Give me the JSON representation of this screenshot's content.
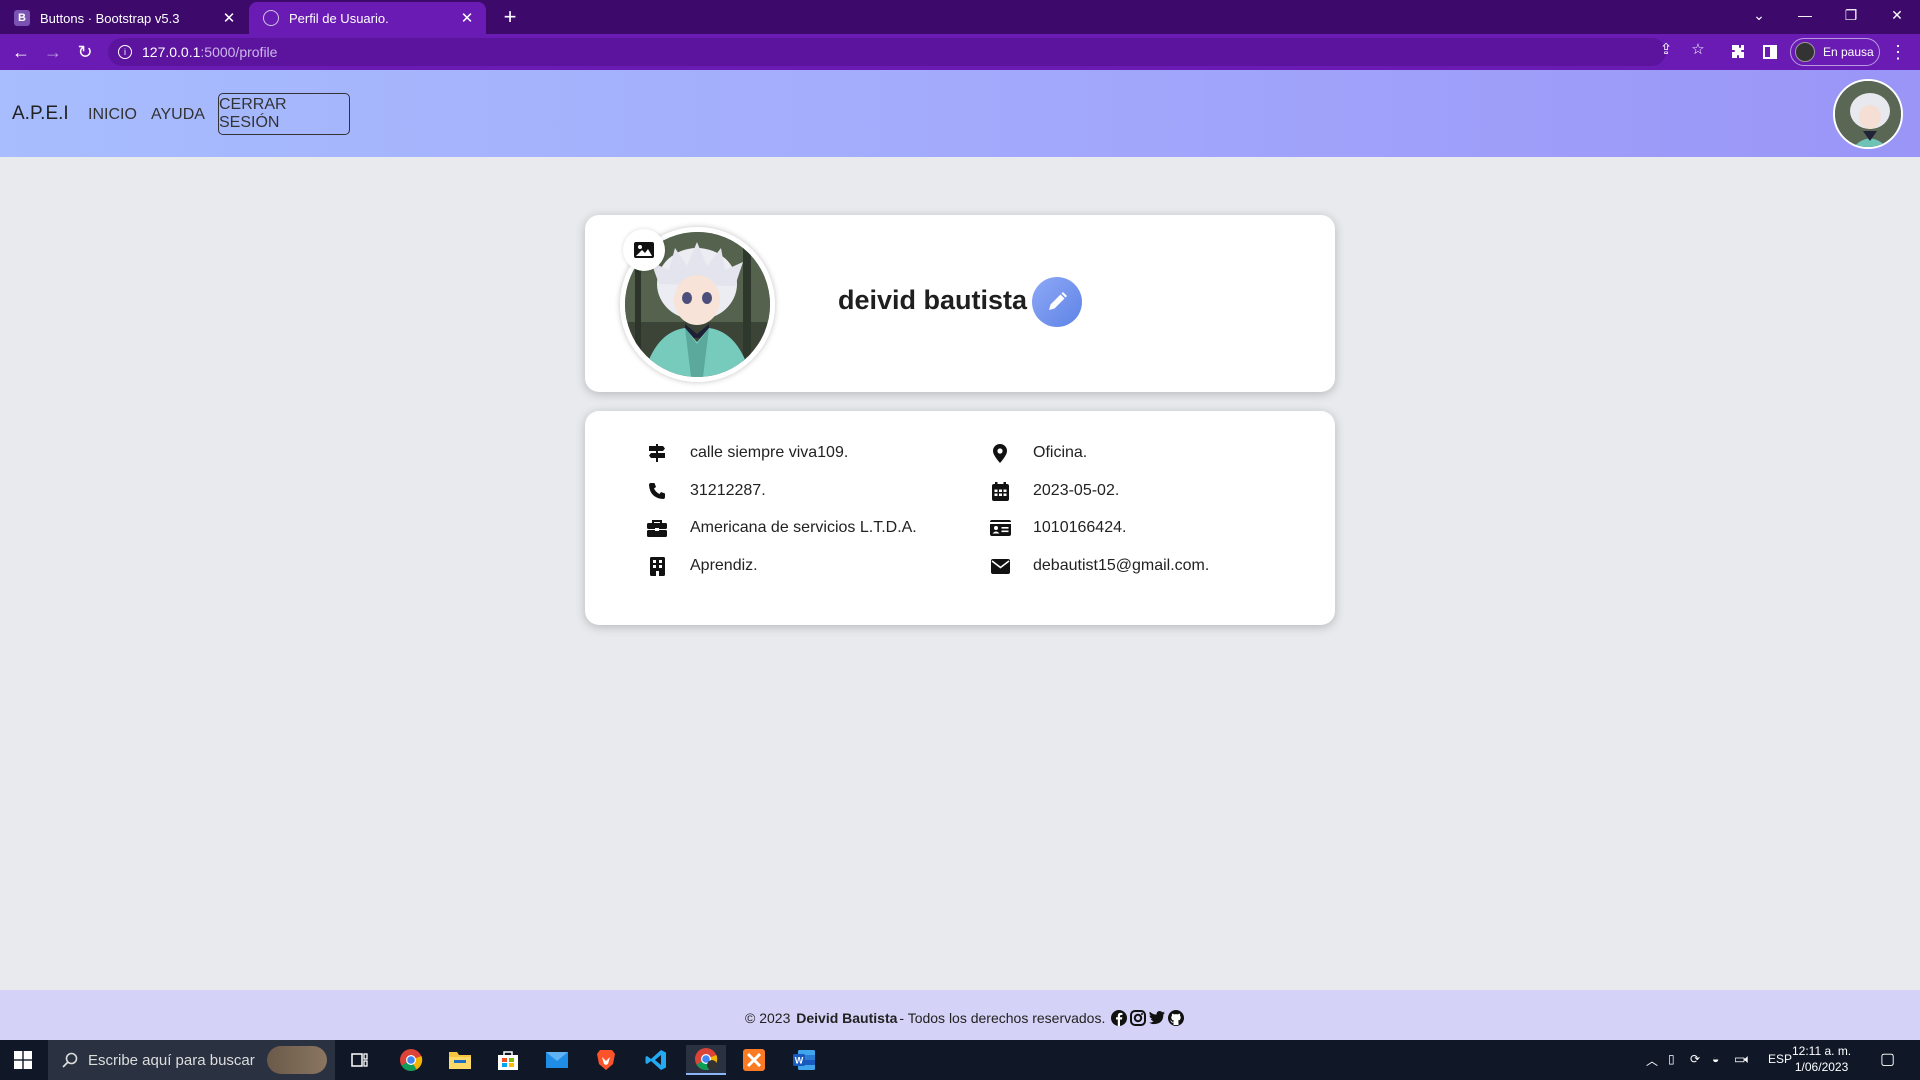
{
  "browser": {
    "tabs": [
      {
        "favicon": "B",
        "title": "Buttons · Bootstrap v5.3"
      },
      {
        "favicon": "globe-icon",
        "title": "Perfil de Usuario."
      }
    ],
    "url_host": "127.0.0.1",
    "url_path": ":5000/profile",
    "profile_label": "En pausa"
  },
  "navbar": {
    "brand": "A.P.E.I",
    "links": [
      "INICIO",
      "AYUDA"
    ],
    "logout": "CERRAR SESIÓN"
  },
  "profile": {
    "name": "deivid bautista"
  },
  "info": {
    "left": [
      {
        "icon": "signpost-icon",
        "text": "calle siempre viva109."
      },
      {
        "icon": "phone-icon",
        "text": "31212287."
      },
      {
        "icon": "briefcase-icon",
        "text": "Americana de servicios L.T.D.A."
      },
      {
        "icon": "building-icon",
        "text": "Aprendiz."
      }
    ],
    "right": [
      {
        "icon": "location-pin-icon",
        "text": "Oficina."
      },
      {
        "icon": "calendar-icon",
        "text": "2023-05-02."
      },
      {
        "icon": "id-card-icon",
        "text": "1010166424."
      },
      {
        "icon": "envelope-icon",
        "text": "debautist15@gmail.com."
      }
    ]
  },
  "footer": {
    "prefix": "© 2023",
    "author": "Deivid Bautista",
    "suffix": "- Todos los derechos reservados.",
    "social": [
      "facebook-icon",
      "instagram-icon",
      "twitter-icon",
      "github-icon"
    ]
  },
  "taskbar": {
    "search_placeholder": "Escribe aquí para buscar",
    "language": "ESP",
    "time": "12:11 a. m.",
    "date": "1/06/2023"
  },
  "colors": {
    "tabbar": "#3d0a6b",
    "addressbar": "#6a1bb4",
    "navbar_start": "#a7bdfd",
    "navbar_end": "#9a95f7",
    "page_bg": "#e8eaee",
    "footer_bg": "#d4d2f7",
    "edit_button": "#6f8fec"
  }
}
